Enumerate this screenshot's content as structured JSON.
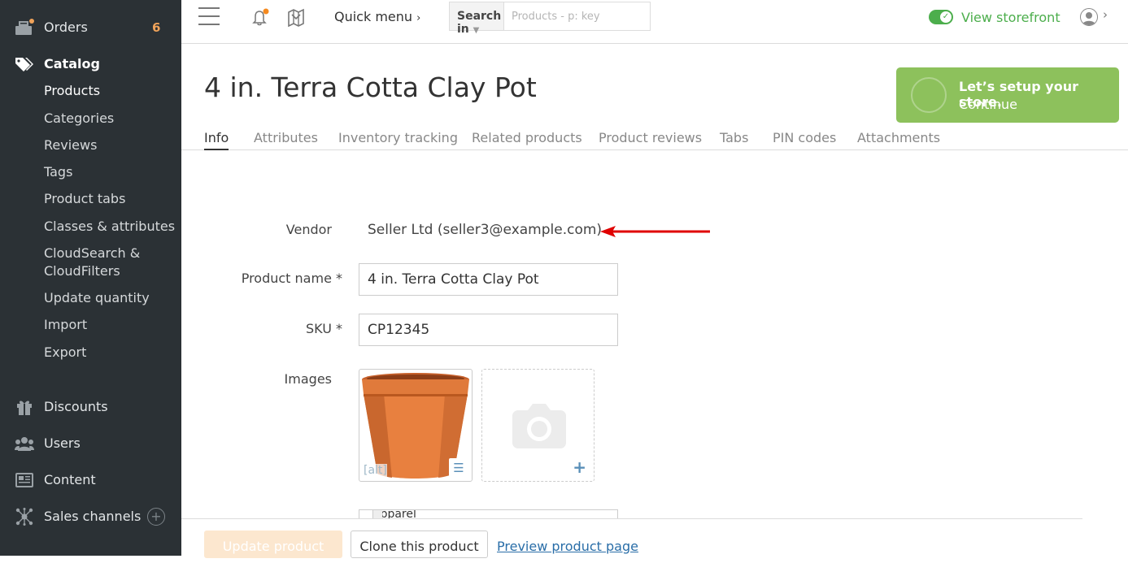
{
  "sidebar": {
    "orders": {
      "label": "Orders",
      "badge": "6"
    },
    "catalog": {
      "label": "Catalog"
    },
    "catalog_items": [
      {
        "label": "Products"
      },
      {
        "label": "Categories"
      },
      {
        "label": "Reviews"
      },
      {
        "label": "Tags"
      },
      {
        "label": "Product tabs"
      },
      {
        "label": "Classes & attributes"
      },
      {
        "label": "CloudSearch &"
      },
      {
        "label": "CloudFilters"
      },
      {
        "label": "Update quantity"
      },
      {
        "label": "Import"
      },
      {
        "label": "Export"
      }
    ],
    "discounts": {
      "label": "Discounts"
    },
    "users": {
      "label": "Users"
    },
    "content": {
      "label": "Content"
    },
    "sales_channels": {
      "label": "Sales channels"
    }
  },
  "topbar": {
    "quick_menu": "Quick menu",
    "search_in": "Search in",
    "search_placeholder": "Products - p: key",
    "view_storefront": "View storefront"
  },
  "page": {
    "title": "4 in. Terra Cotta Clay Pot"
  },
  "setup_banner": {
    "line1": "Let’s setup your store.",
    "line2": "Continue"
  },
  "tabs": [
    {
      "label": "Info",
      "active": true
    },
    {
      "label": "Attributes"
    },
    {
      "label": "Inventory tracking"
    },
    {
      "label": "Related products"
    },
    {
      "label": "Product reviews"
    },
    {
      "label": "Tabs"
    },
    {
      "label": "PIN codes"
    },
    {
      "label": "Attachments"
    }
  ],
  "form": {
    "vendor_label": "Vendor",
    "vendor_value": "Seller Ltd (seller3@example.com)",
    "product_name_label": "Product name *",
    "product_name_value": "4 in. Terra Cotta Clay Pot",
    "sku_label": "SKU *",
    "sku_value": "CP12345",
    "images_label": "Images",
    "image_alt": "[alt]",
    "category_value": "Apparel"
  },
  "actions": {
    "update": "Update product",
    "clone": "Clone this product",
    "preview": "Preview product page"
  },
  "colors": {
    "sidebar_bg": "#2b3135",
    "accent_green": "#4cae4c",
    "setup_green": "#8dc15c",
    "badge_orange": "#f0a35a",
    "arrow_red": "#e00000",
    "link_blue": "#2a6ea8"
  }
}
